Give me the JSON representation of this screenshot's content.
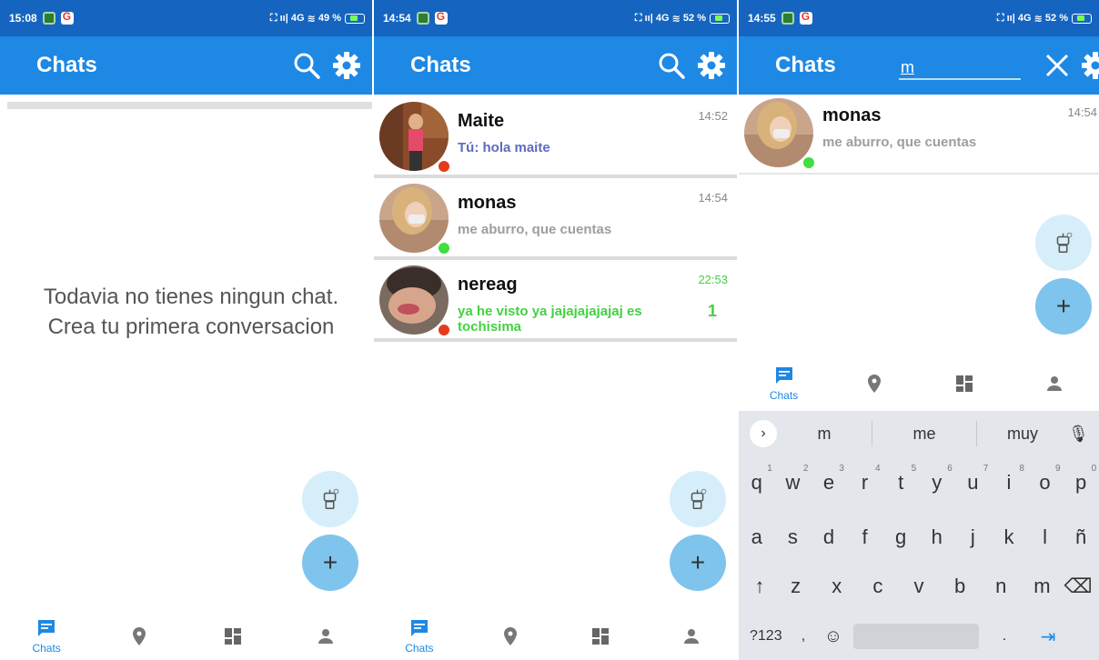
{
  "app_title": "Chats",
  "screens": [
    {
      "time": "15:08",
      "battery": "49 %",
      "network": "4G",
      "empty_message": "Todavia no tienes ningun chat. Crea tu primera conversacion"
    },
    {
      "time": "14:54",
      "battery": "52 %",
      "network": "4G",
      "chats": [
        {
          "name": "Maite",
          "message": "Tú: hola maite",
          "time": "14:52",
          "status": "offline",
          "message_color": "#5c6bc0"
        },
        {
          "name": "monas",
          "message": "me aburro, que cuentas",
          "time": "14:54",
          "status": "online",
          "message_color": "#9e9e9e"
        },
        {
          "name": "nereag",
          "message": "ya he visto ya jajajajajajaj es tochisima",
          "time": "22:53",
          "status": "offline",
          "unread": "1",
          "message_color": "#43d143"
        }
      ]
    },
    {
      "time": "14:55",
      "battery": "52 %",
      "network": "4G",
      "search_query": "m",
      "chats": [
        {
          "name": "monas",
          "message": "me aburro, que cuentas",
          "time": "14:54",
          "status": "online"
        }
      ],
      "keyboard": {
        "suggestions": [
          "m",
          "me",
          "muy"
        ],
        "row1": [
          "q",
          "w",
          "e",
          "r",
          "t",
          "y",
          "u",
          "i",
          "o",
          "p"
        ],
        "row1_digits": [
          "1",
          "2",
          "3",
          "4",
          "5",
          "6",
          "7",
          "8",
          "9",
          "0"
        ],
        "row2": [
          "a",
          "s",
          "d",
          "f",
          "g",
          "h",
          "j",
          "k",
          "l",
          "ñ"
        ],
        "row3": [
          "z",
          "x",
          "c",
          "v",
          "b",
          "n",
          "m"
        ],
        "row4_left": "?123",
        "comma": ",",
        "period": "."
      }
    }
  ],
  "bottom_nav": {
    "chats_label": "Chats"
  },
  "colors": {
    "status_bar": "#1565c0",
    "app_bar": "#1e88e5",
    "accent": "#1e88e5",
    "online": "#3de03d",
    "offline": "#e53a1b"
  }
}
